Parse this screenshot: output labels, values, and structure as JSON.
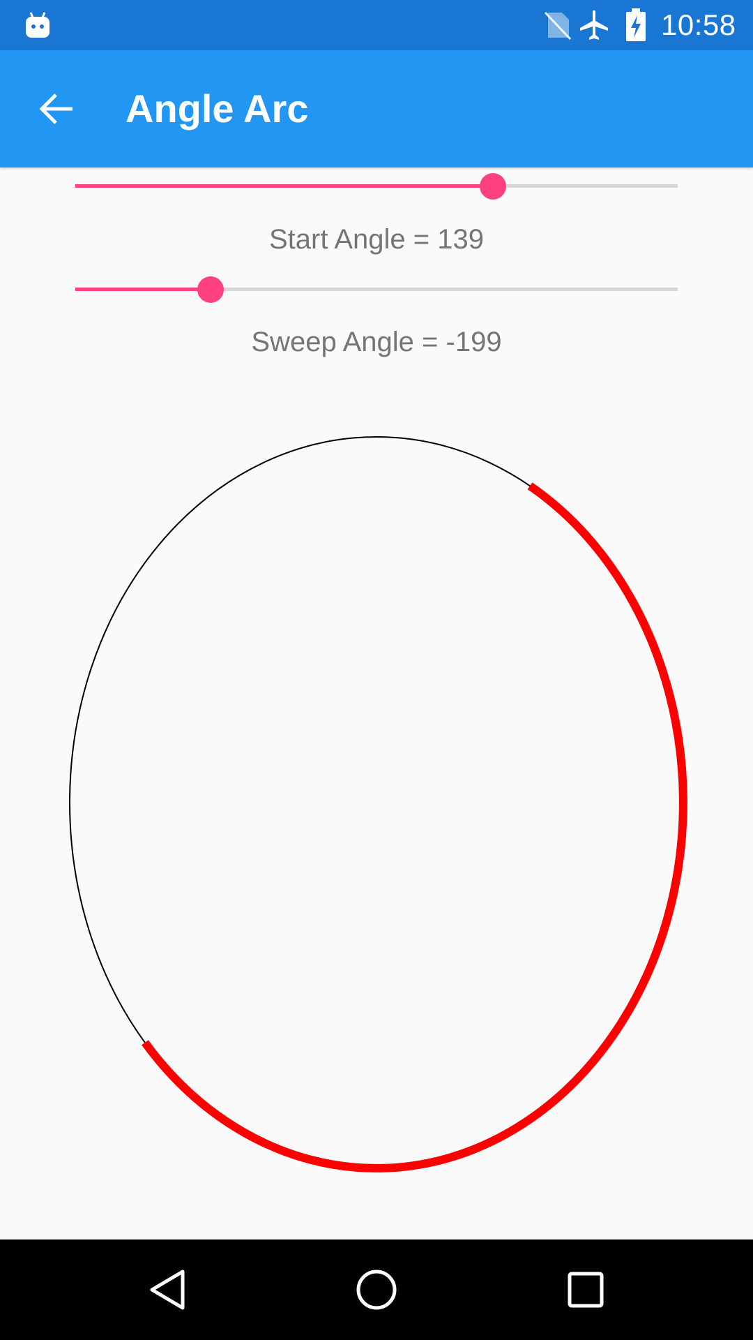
{
  "status_bar": {
    "time": "10:58",
    "icons": [
      "android-notification-icon",
      "no-sim-icon",
      "airplane-mode-icon",
      "battery-charging-icon"
    ]
  },
  "toolbar": {
    "title": "Angle Arc",
    "back_icon": "arrow-back-icon"
  },
  "start_slider": {
    "fraction": 0.693,
    "label": "Start Angle = 139"
  },
  "sweep_slider": {
    "fraction": 0.224,
    "label": "Sweep Angle = -199"
  },
  "arc": {
    "start_angle": 139,
    "sweep_angle": -199,
    "oval_color": "#000000",
    "arc_color": "#ff0000"
  },
  "nav_bar": {
    "icons": [
      "back-triangle-icon",
      "home-circle-icon",
      "recents-square-icon"
    ]
  },
  "colors": {
    "status_bar": "#1976d2",
    "toolbar": "#2196f3",
    "accent": "#ff4081",
    "background": "#fafafa"
  }
}
